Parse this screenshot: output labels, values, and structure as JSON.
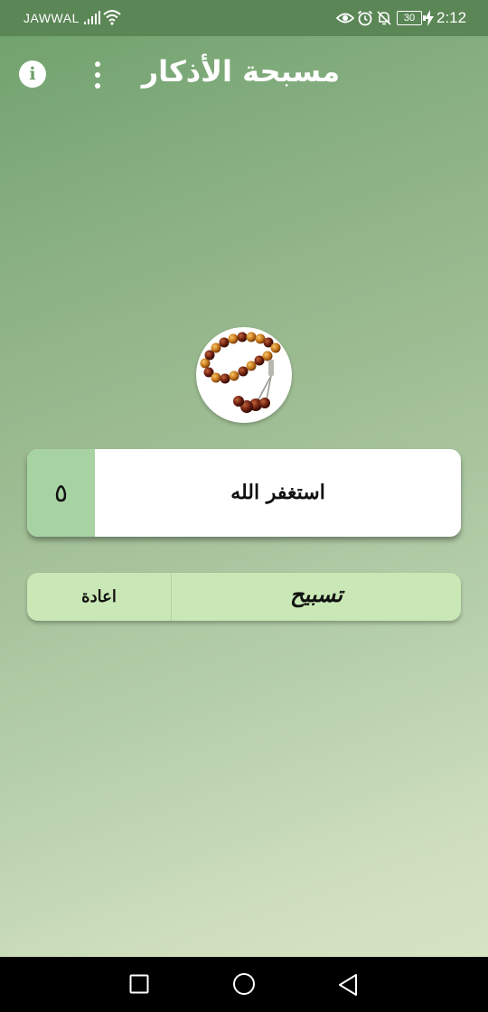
{
  "status_bar": {
    "carrier": "JAWWAL",
    "battery_level": "30",
    "time": "2:12",
    "icons": [
      "signal-icon",
      "wifi-icon",
      "eye-icon",
      "alarm-icon",
      "mute-icon",
      "charging-icon"
    ]
  },
  "app_bar": {
    "title": "مسبحة الأذكار",
    "info_icon_glyph": "i",
    "icons": [
      "info-icon",
      "more-vert-icon"
    ]
  },
  "beads_image": {
    "icon": "prayer-beads-image"
  },
  "dhikr": {
    "text": "استغفر الله",
    "count": "٥"
  },
  "buttons": {
    "tasbih_label": "تسبيح",
    "reset_label": "اعادة"
  },
  "nav_bar": {
    "icons": [
      "back-icon",
      "home-icon",
      "recents-icon"
    ]
  },
  "colors": {
    "status_bar": "#5b8656",
    "background_top": "#6ea06a",
    "background_bottom": "#dbe6c6",
    "counter_box": "#a7d3a3",
    "button_bg": "#c9e8b5",
    "nav_bar": "#000000"
  }
}
